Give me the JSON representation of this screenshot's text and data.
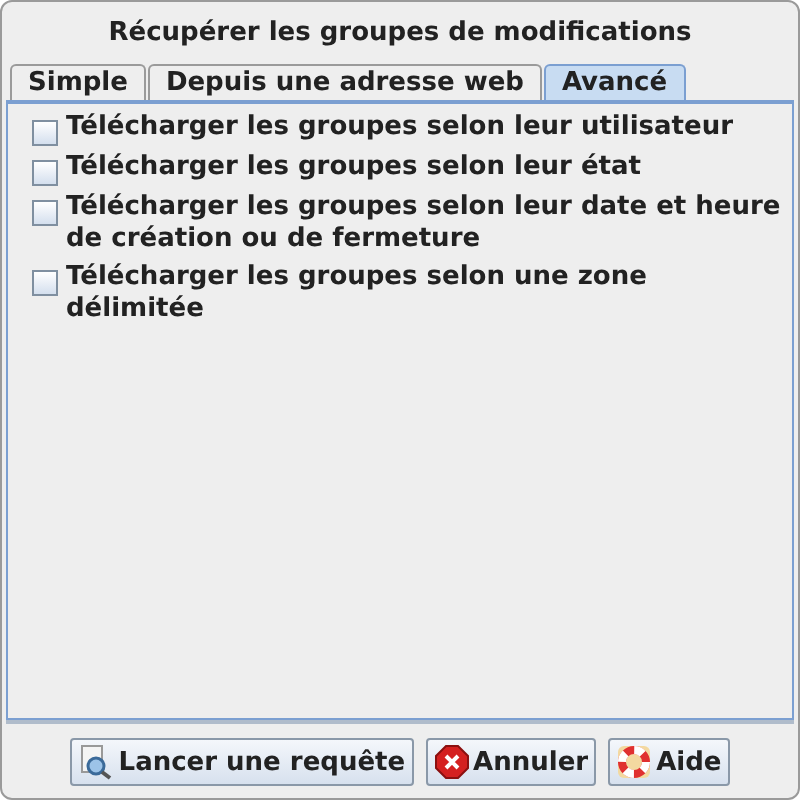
{
  "window": {
    "title": "Récupérer les groupes de modifications"
  },
  "tabs": [
    {
      "label": "Simple",
      "selected": false
    },
    {
      "label": "Depuis une adresse web",
      "selected": false
    },
    {
      "label": "Avancé",
      "selected": true
    }
  ],
  "options": [
    {
      "label": "Télécharger les groupes selon leur utilisateur",
      "checked": false
    },
    {
      "label": "Télécharger les groupes selon leur état",
      "checked": false
    },
    {
      "label": "Télécharger les groupes selon leur date et heure de création ou de fermeture",
      "checked": false
    },
    {
      "label": "Télécharger les groupes selon une zone délimitée",
      "checked": false
    }
  ],
  "buttons": [
    {
      "label": "Lancer une requête",
      "kind": "query"
    },
    {
      "label": "Annuler",
      "kind": "cancel"
    },
    {
      "label": "Aide",
      "kind": "help"
    }
  ]
}
